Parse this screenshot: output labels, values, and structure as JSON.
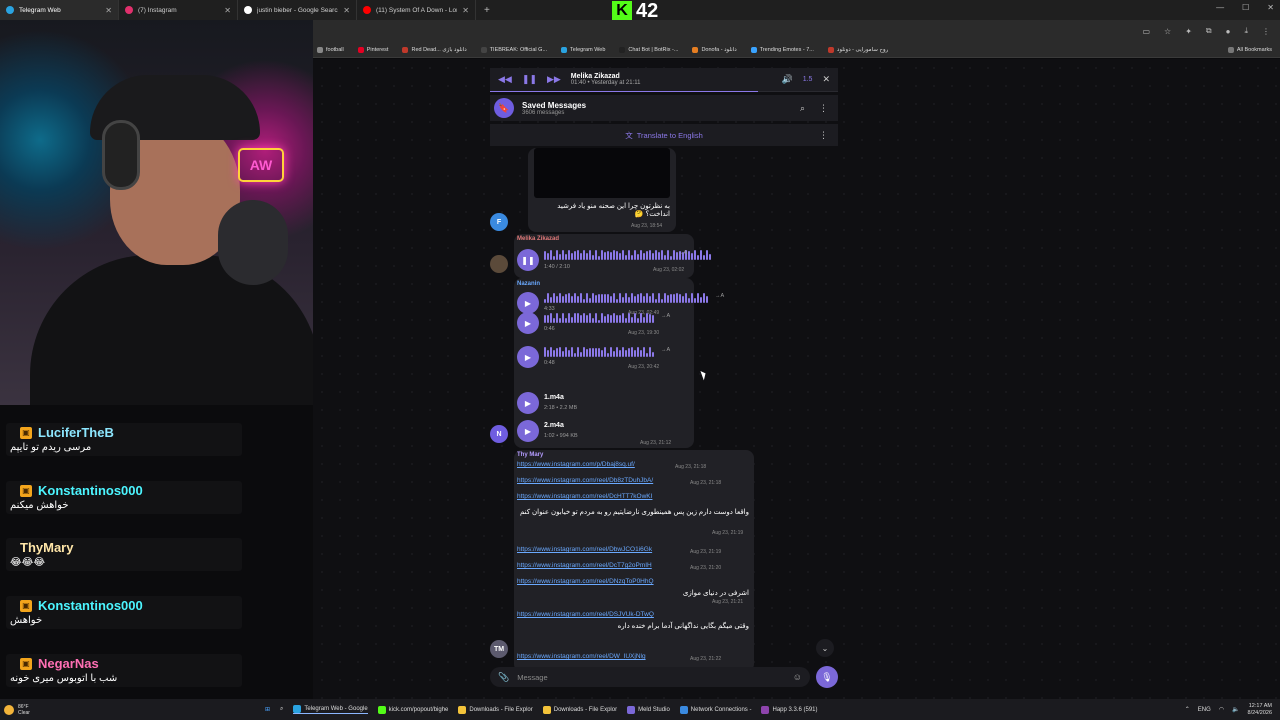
{
  "browser": {
    "tabs": [
      {
        "label": "Telegram Web",
        "color": "#2aa3e0",
        "active": true
      },
      {
        "label": "(7) Instagram",
        "color": "#e1306c",
        "active": false
      },
      {
        "label": "justin bieber - Google Search",
        "color": "#ffffff",
        "active": false
      },
      {
        "label": "(11) System Of A Down - Lonel",
        "color": "#ff0000",
        "active": false
      }
    ],
    "bookmarks": [
      {
        "label": "football",
        "color": "#888"
      },
      {
        "label": "Pinterest",
        "color": "#e60023"
      },
      {
        "label": "Red Dead... دانلود بازی",
        "color": "#c0392b"
      },
      {
        "label": "TIEBREAK: Official G...",
        "color": "#444"
      },
      {
        "label": "Telegram Web",
        "color": "#2aa3e0"
      },
      {
        "label": "Chat Bot | BotRix -...",
        "color": "#222"
      },
      {
        "label": "Donofa - دانلود",
        "color": "#e67e22"
      },
      {
        "label": "Trending Emotes - 7...",
        "color": "#3aa3ff"
      },
      {
        "label": "روح سامورایی - دونلود",
        "color": "#c0392b"
      }
    ],
    "all_bookmarks": "All Bookmarks"
  },
  "overlay": {
    "k_letter": "K",
    "k_count": "42",
    "neon_text": "AW"
  },
  "chat": [
    {
      "user": "LuciferTheB",
      "text": "مرسی ریدم تو تایپم",
      "cls": "u1",
      "badge": true
    },
    {
      "user": "Konstantinos000",
      "text": "خواهش میکنم",
      "cls": "u2",
      "badge": true
    },
    {
      "user": "ThyMary",
      "text": "😂😂😂",
      "cls": "u3",
      "badge": false
    },
    {
      "user": "Konstantinos000",
      "text": "خواهش",
      "cls": "u2",
      "badge": true
    },
    {
      "user": "NegarNas",
      "text": "شب با اتوبوس میری خونه",
      "cls": "u4",
      "badge": true
    }
  ],
  "telegram": {
    "player": {
      "name": "Melika Zikazad",
      "time": "01:40 • Yesterday at 21:11",
      "speed": "1.5"
    },
    "header": {
      "title": "Saved Messages",
      "subtitle": "3606 messages"
    },
    "translate": "Translate to English",
    "composer_placeholder": "Message",
    "msg1": {
      "text": "به نظرتون چرا این صحنه منو یاد فرشید انداخت؟ 🤔",
      "stamp": "Aug 23, 18:54",
      "avatar": "F"
    },
    "voice1": {
      "sender": "Melika Zikazad",
      "dur": "1:40 / 2:10",
      "stamp": "Aug 23, 02:02"
    },
    "voice_group": {
      "sender": "Nazanin",
      "avatar": "N",
      "items": [
        {
          "dur": "4:33",
          "stamp": "Aug 23, 02:49"
        },
        {
          "dur": "0:46",
          "stamp": "Aug 23, 19:30"
        },
        {
          "dur": "0:48",
          "stamp": "Aug 23, 20:42"
        }
      ],
      "files": [
        {
          "name": "1.m4a",
          "size": "2:18 • 2.2 MB"
        },
        {
          "name": "2.m4a",
          "size": "1:02 • 994 KB"
        }
      ],
      "files_stamp": "Aug 23, 21:12"
    },
    "links_group": {
      "sender": "Thy Mary",
      "avatar": "TM",
      "items": [
        {
          "link": "https://www.instagram.com/p/Dbaj8sq.uf/",
          "stamp": "Aug 23, 21:18"
        },
        {
          "link": "https://www.instagram.com/reel/Db8zTDuhJbA/",
          "stamp": "Aug 23, 21:18"
        },
        {
          "link": "https://www.instagram.com/reel/DcHTT7kOwKI",
          "text": "واقعا دوست دارم زین پس همینطوری نارضایتیم رو به مردم تو خیابون عنوان کنم",
          "stamp": "Aug 23, 21:19"
        },
        {
          "link": "https://www.instagram.com/reel/DbwJCO1i6Gk",
          "stamp": "Aug 23, 21:19"
        },
        {
          "link": "https://www.instagram.com/reel/DcT7g2oPmIH",
          "stamp": "Aug 23, 21:20"
        },
        {
          "link": "https://www.instagram.com/reel/DNzqToP0HhQ",
          "text": "اشرفی در دنیای موازی",
          "stamp": "Aug 23, 21:21"
        },
        {
          "link": "https://www.instagram.com/reel/DSJVUk-DTwQ",
          "text": "وقتی میگم بگایی نداگهانی آدما برام خنده داره",
          "stamp": ""
        },
        {
          "link": "https://www.instagram.com/reel/DW_IUXjNlg",
          "stamp": "Aug 23, 21:22"
        }
      ]
    }
  },
  "taskbar": {
    "weather_temp": "86°F",
    "weather_desc": "Clear",
    "items": [
      {
        "label": "Telegram Web - Google",
        "color": "#2aa3e0",
        "active": true
      },
      {
        "label": "kick.com/popout/bighe",
        "color": "#53fc18",
        "active": false
      },
      {
        "label": "Downloads - File Explor",
        "color": "#f3c33a",
        "active": false
      },
      {
        "label": "Downloads - File Explor",
        "color": "#f3c33a",
        "active": false
      },
      {
        "label": "Meld Studio",
        "color": "#7b68d8",
        "active": false
      },
      {
        "label": "Network Connections -",
        "color": "#3a8ae0",
        "active": false
      },
      {
        "label": "Happ 3.3.6 (591)",
        "color": "#8e44ad",
        "active": false
      }
    ],
    "lang": "ENG",
    "time": "12:17 AM",
    "date": "8/24/2026"
  }
}
